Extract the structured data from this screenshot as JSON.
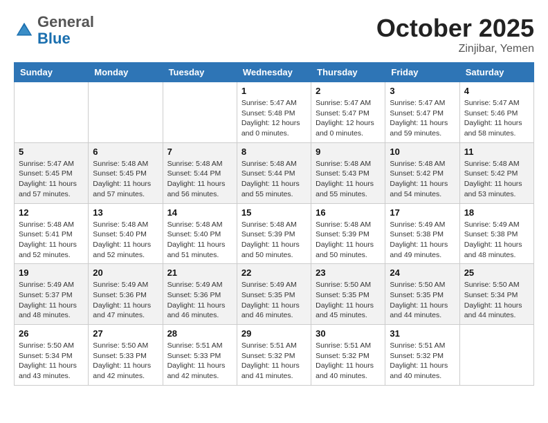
{
  "header": {
    "logo_general": "General",
    "logo_blue": "Blue",
    "month": "October 2025",
    "location": "Zinjibar, Yemen"
  },
  "weekdays": [
    "Sunday",
    "Monday",
    "Tuesday",
    "Wednesday",
    "Thursday",
    "Friday",
    "Saturday"
  ],
  "weeks": [
    [
      {
        "num": "",
        "info": ""
      },
      {
        "num": "",
        "info": ""
      },
      {
        "num": "",
        "info": ""
      },
      {
        "num": "1",
        "info": "Sunrise: 5:47 AM\nSunset: 5:48 PM\nDaylight: 12 hours\nand 0 minutes."
      },
      {
        "num": "2",
        "info": "Sunrise: 5:47 AM\nSunset: 5:47 PM\nDaylight: 12 hours\nand 0 minutes."
      },
      {
        "num": "3",
        "info": "Sunrise: 5:47 AM\nSunset: 5:47 PM\nDaylight: 11 hours\nand 59 minutes."
      },
      {
        "num": "4",
        "info": "Sunrise: 5:47 AM\nSunset: 5:46 PM\nDaylight: 11 hours\nand 58 minutes."
      }
    ],
    [
      {
        "num": "5",
        "info": "Sunrise: 5:47 AM\nSunset: 5:45 PM\nDaylight: 11 hours\nand 57 minutes."
      },
      {
        "num": "6",
        "info": "Sunrise: 5:48 AM\nSunset: 5:45 PM\nDaylight: 11 hours\nand 57 minutes."
      },
      {
        "num": "7",
        "info": "Sunrise: 5:48 AM\nSunset: 5:44 PM\nDaylight: 11 hours\nand 56 minutes."
      },
      {
        "num": "8",
        "info": "Sunrise: 5:48 AM\nSunset: 5:44 PM\nDaylight: 11 hours\nand 55 minutes."
      },
      {
        "num": "9",
        "info": "Sunrise: 5:48 AM\nSunset: 5:43 PM\nDaylight: 11 hours\nand 55 minutes."
      },
      {
        "num": "10",
        "info": "Sunrise: 5:48 AM\nSunset: 5:42 PM\nDaylight: 11 hours\nand 54 minutes."
      },
      {
        "num": "11",
        "info": "Sunrise: 5:48 AM\nSunset: 5:42 PM\nDaylight: 11 hours\nand 53 minutes."
      }
    ],
    [
      {
        "num": "12",
        "info": "Sunrise: 5:48 AM\nSunset: 5:41 PM\nDaylight: 11 hours\nand 52 minutes."
      },
      {
        "num": "13",
        "info": "Sunrise: 5:48 AM\nSunset: 5:40 PM\nDaylight: 11 hours\nand 52 minutes."
      },
      {
        "num": "14",
        "info": "Sunrise: 5:48 AM\nSunset: 5:40 PM\nDaylight: 11 hours\nand 51 minutes."
      },
      {
        "num": "15",
        "info": "Sunrise: 5:48 AM\nSunset: 5:39 PM\nDaylight: 11 hours\nand 50 minutes."
      },
      {
        "num": "16",
        "info": "Sunrise: 5:48 AM\nSunset: 5:39 PM\nDaylight: 11 hours\nand 50 minutes."
      },
      {
        "num": "17",
        "info": "Sunrise: 5:49 AM\nSunset: 5:38 PM\nDaylight: 11 hours\nand 49 minutes."
      },
      {
        "num": "18",
        "info": "Sunrise: 5:49 AM\nSunset: 5:38 PM\nDaylight: 11 hours\nand 48 minutes."
      }
    ],
    [
      {
        "num": "19",
        "info": "Sunrise: 5:49 AM\nSunset: 5:37 PM\nDaylight: 11 hours\nand 48 minutes."
      },
      {
        "num": "20",
        "info": "Sunrise: 5:49 AM\nSunset: 5:36 PM\nDaylight: 11 hours\nand 47 minutes."
      },
      {
        "num": "21",
        "info": "Sunrise: 5:49 AM\nSunset: 5:36 PM\nDaylight: 11 hours\nand 46 minutes."
      },
      {
        "num": "22",
        "info": "Sunrise: 5:49 AM\nSunset: 5:35 PM\nDaylight: 11 hours\nand 46 minutes."
      },
      {
        "num": "23",
        "info": "Sunrise: 5:50 AM\nSunset: 5:35 PM\nDaylight: 11 hours\nand 45 minutes."
      },
      {
        "num": "24",
        "info": "Sunrise: 5:50 AM\nSunset: 5:35 PM\nDaylight: 11 hours\nand 44 minutes."
      },
      {
        "num": "25",
        "info": "Sunrise: 5:50 AM\nSunset: 5:34 PM\nDaylight: 11 hours\nand 44 minutes."
      }
    ],
    [
      {
        "num": "26",
        "info": "Sunrise: 5:50 AM\nSunset: 5:34 PM\nDaylight: 11 hours\nand 43 minutes."
      },
      {
        "num": "27",
        "info": "Sunrise: 5:50 AM\nSunset: 5:33 PM\nDaylight: 11 hours\nand 42 minutes."
      },
      {
        "num": "28",
        "info": "Sunrise: 5:51 AM\nSunset: 5:33 PM\nDaylight: 11 hours\nand 42 minutes."
      },
      {
        "num": "29",
        "info": "Sunrise: 5:51 AM\nSunset: 5:32 PM\nDaylight: 11 hours\nand 41 minutes."
      },
      {
        "num": "30",
        "info": "Sunrise: 5:51 AM\nSunset: 5:32 PM\nDaylight: 11 hours\nand 40 minutes."
      },
      {
        "num": "31",
        "info": "Sunrise: 5:51 AM\nSunset: 5:32 PM\nDaylight: 11 hours\nand 40 minutes."
      },
      {
        "num": "",
        "info": ""
      }
    ]
  ]
}
